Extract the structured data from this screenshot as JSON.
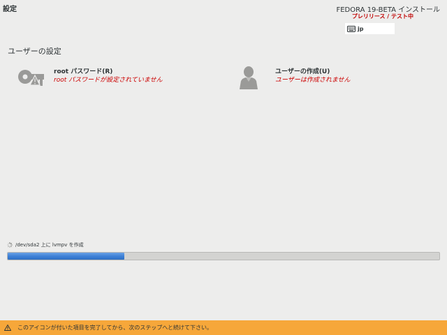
{
  "header": {
    "screen_title": "設定",
    "product_name": "FEDORA 19-BETA インストール",
    "prerelease_label": "プレリリース / テスト中",
    "keyboard_layout": "jp",
    "keyboard_icon": "keyboard-icon"
  },
  "section": {
    "title": "ユーザーの設定"
  },
  "spokes": {
    "root": {
      "label": "root パスワード(R)",
      "status": "root パスワードが設定されていません",
      "icon": "key-icon"
    },
    "user": {
      "label": "ユーザーの作成(U)",
      "status": "ユーザーは作成されません",
      "icon": "user-icon"
    }
  },
  "progress": {
    "label": "/dev/sda2 上に lvmpv を作成",
    "fraction": 0.27,
    "icon": "spinner-icon"
  },
  "warning": {
    "text": "このアイコンが付いた項目を完了してから、次のステップへと続けて下さい。",
    "icon": "warning-icon"
  },
  "colors": {
    "background": "#ededec",
    "status_text": "#cc0000",
    "prerelease": "#c00000",
    "progress_fill": "#3b7fd6",
    "warning_bar": "#f6a73a"
  }
}
